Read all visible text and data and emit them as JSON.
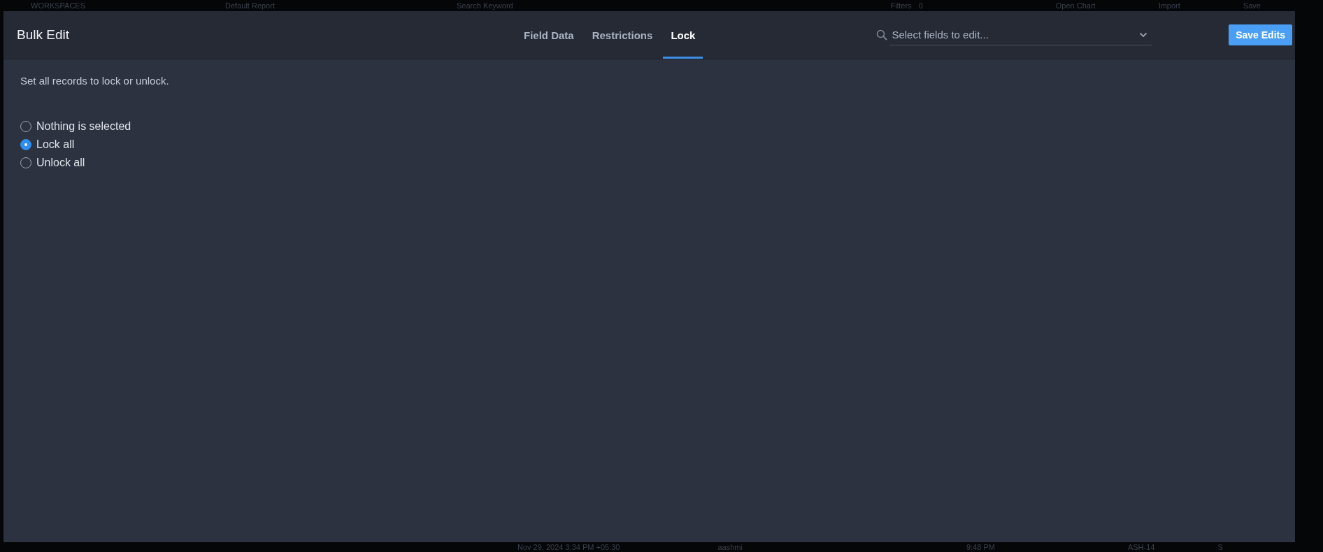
{
  "background": {
    "top_items": [
      "WORKSPACES",
      "Default Report",
      "Search Keyword",
      "Filters",
      "0",
      "Open Chart",
      "Import",
      "Save"
    ],
    "bottom_items": [
      "Nov 29, 2024 3:34 PM +05:30",
      "aashmi",
      "9:48 PM",
      "ASH-14",
      "S"
    ]
  },
  "dialog": {
    "title": "Bulk Edit",
    "tabs": [
      {
        "label": "Field Data",
        "selected": false
      },
      {
        "label": "Restrictions",
        "selected": false
      },
      {
        "label": "Lock",
        "selected": true
      }
    ],
    "field_select": {
      "placeholder": "Select fields to edit..."
    },
    "save_button": "Save Edits",
    "description": "Set all records to lock or unlock.",
    "options": [
      {
        "label": "Nothing is selected",
        "selected": false
      },
      {
        "label": "Lock all",
        "selected": true
      },
      {
        "label": "Unlock all",
        "selected": false
      }
    ]
  }
}
